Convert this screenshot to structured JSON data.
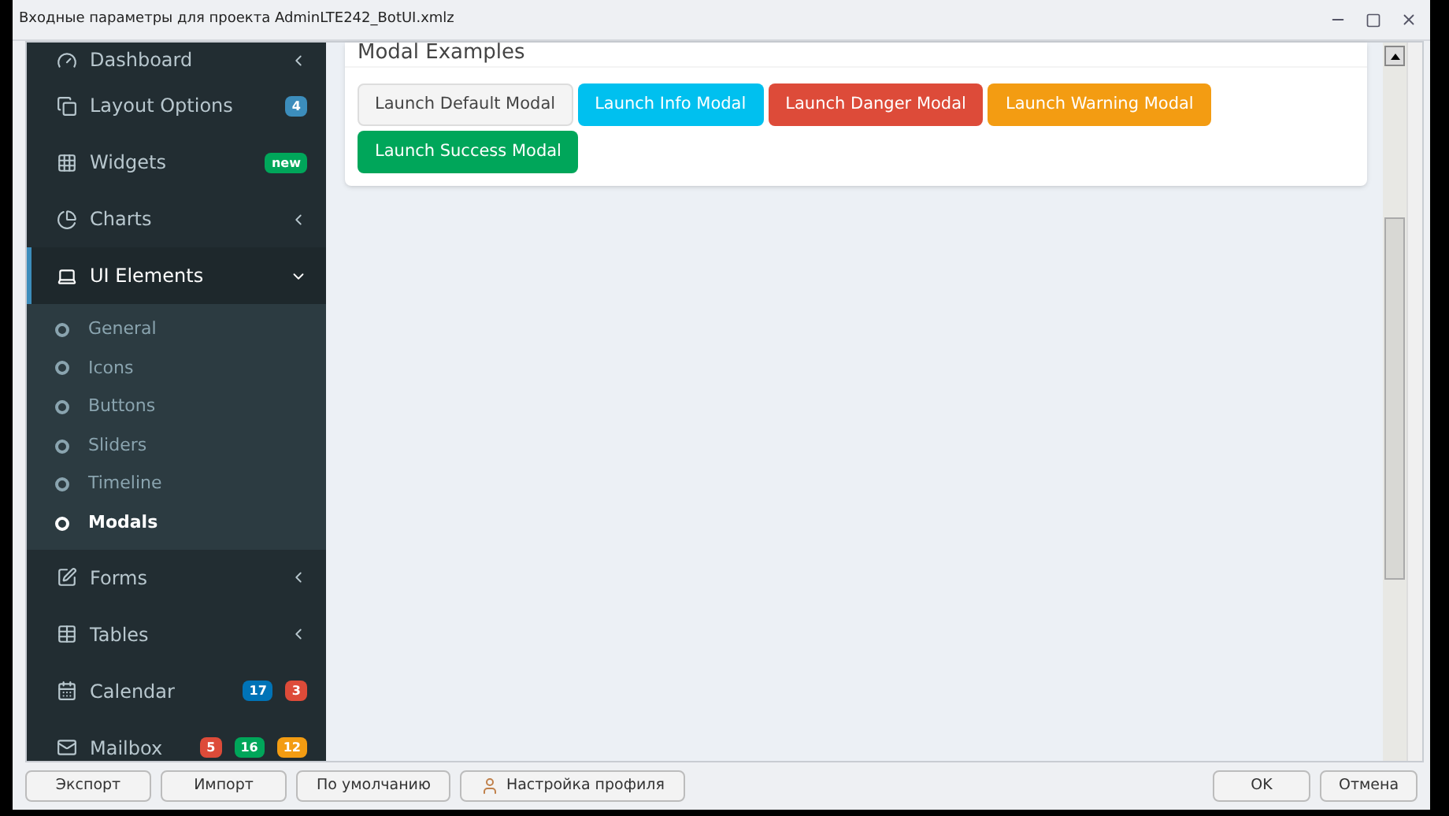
{
  "window": {
    "title": "Входные параметры для проекта AdminLTE242_BotUI.xmlz"
  },
  "sidebar": {
    "items": [
      {
        "label": "Dashboard",
        "expanded": false,
        "active": false
      },
      {
        "label": "Layout Options",
        "badges": [
          {
            "text": "4",
            "color": "#3c8dbc"
          }
        ],
        "active": false
      },
      {
        "label": "Widgets",
        "badges": [
          {
            "text": "new",
            "color": "#00a65a"
          }
        ],
        "active": false
      },
      {
        "label": "Charts",
        "expanded": false,
        "active": false
      },
      {
        "label": "UI Elements",
        "expanded": true,
        "active": true,
        "children": [
          {
            "label": "General",
            "selected": false
          },
          {
            "label": "Icons",
            "selected": false
          },
          {
            "label": "Buttons",
            "selected": false
          },
          {
            "label": "Sliders",
            "selected": false
          },
          {
            "label": "Timeline",
            "selected": false
          },
          {
            "label": "Modals",
            "selected": true
          }
        ]
      },
      {
        "label": "Forms",
        "expanded": false,
        "active": false
      },
      {
        "label": "Tables",
        "expanded": false,
        "active": false
      },
      {
        "label": "Calendar",
        "badges": [
          {
            "text": "17",
            "color": "#0073b7"
          },
          {
            "text": "3",
            "color": "#dd4b39"
          }
        ],
        "active": false
      },
      {
        "label": "Mailbox",
        "badges": [
          {
            "text": "5",
            "color": "#dd4b39"
          },
          {
            "text": "16",
            "color": "#00a65a"
          },
          {
            "text": "12",
            "color": "#f39c12"
          }
        ],
        "active": false
      }
    ]
  },
  "card": {
    "title": "Modal Examples",
    "buttons": [
      {
        "label": "Launch Default Modal",
        "color": "#f4f4f4"
      },
      {
        "label": "Launch Info Modal",
        "color": "#00c0ef"
      },
      {
        "label": "Launch Danger Modal",
        "color": "#dd4b39"
      },
      {
        "label": "Launch Warning Modal",
        "color": "#f39c12"
      },
      {
        "label": "Launch Success Modal",
        "color": "#00a65a"
      }
    ]
  },
  "footer": {
    "left_buttons": [
      {
        "label": "Экспорт",
        "kind": "plain"
      },
      {
        "label": "Импорт",
        "kind": "plain"
      },
      {
        "label": "По умолчанию",
        "kind": "plain"
      },
      {
        "label": "Настройка профиля",
        "kind": "profile"
      }
    ],
    "right_buttons": [
      {
        "label": "OK"
      },
      {
        "label": "Отмена"
      }
    ]
  }
}
